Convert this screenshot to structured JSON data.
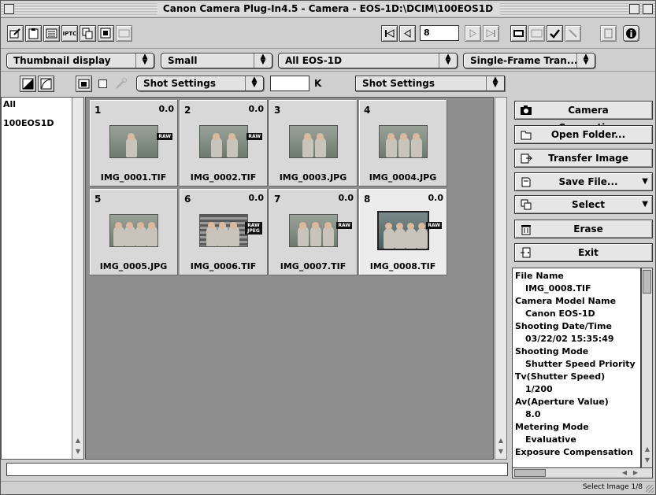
{
  "window": {
    "title": "Canon Camera Plug-In4.5 - Camera - EOS-1D:\\DCIM\\100EOS1D"
  },
  "toolbar": {
    "iptc_label": "IPTC",
    "frame_number": "8"
  },
  "options": {
    "display_mode": "Thumbnail display",
    "size": "Small",
    "camera_filter": "All EOS-1D",
    "transfer_mode": "Single-Frame Tran..."
  },
  "settings": {
    "shot_settings_1": "Shot Settings",
    "kelvin_value": "",
    "kelvin_unit": "K",
    "shot_settings_2": "Shot Settings"
  },
  "folders": [
    {
      "label": "All"
    },
    {
      "label": "100EOS1D"
    }
  ],
  "thumbnails": [
    {
      "index": "1",
      "value": "0.0",
      "name": "IMG_0001.TIF",
      "badge": "RAW"
    },
    {
      "index": "2",
      "value": "0.0",
      "name": "IMG_0002.TIF",
      "badge": "RAW"
    },
    {
      "index": "3",
      "value": "",
      "name": "IMG_0003.JPG",
      "badge": ""
    },
    {
      "index": "4",
      "value": "",
      "name": "IMG_0004.JPG",
      "badge": ""
    },
    {
      "index": "5",
      "value": "",
      "name": "IMG_0005.JPG",
      "badge": ""
    },
    {
      "index": "6",
      "value": "0.0",
      "name": "IMG_0006.TIF",
      "badge": "RAW JPEG"
    },
    {
      "index": "7",
      "value": "0.0",
      "name": "IMG_0007.TIF",
      "badge": "RAW"
    },
    {
      "index": "8",
      "value": "0.0",
      "name": "IMG_0008.TIF",
      "badge": "RAW"
    }
  ],
  "actions": {
    "camera_connection": "Camera Connection",
    "open_folder": "Open Folder...",
    "transfer_image": "Transfer Image",
    "save_file": "Save File...",
    "select": "Select",
    "erase": "Erase",
    "exit": "Exit"
  },
  "info": [
    {
      "label": "File Name",
      "value": "IMG_0008.TIF"
    },
    {
      "label": "Camera Model Name",
      "value": "Canon EOS-1D"
    },
    {
      "label": "Shooting Date/Time",
      "value": "03/22/02 15:35:49"
    },
    {
      "label": "Shooting Mode",
      "value": "Shutter Speed Priority"
    },
    {
      "label": "Tv(Shutter Speed)",
      "value": "1/200"
    },
    {
      "label": "Av(Aperture Value)",
      "value": "8.0"
    },
    {
      "label": "Metering Mode",
      "value": "Evaluative"
    },
    {
      "label": "Exposure Compensation",
      "value": ""
    }
  ],
  "status": {
    "message": "",
    "text": "Select Image 1/8"
  }
}
